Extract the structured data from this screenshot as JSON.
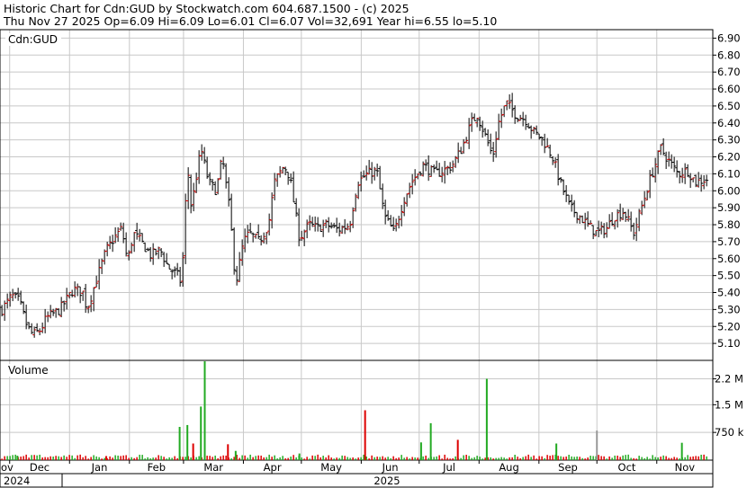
{
  "header": {
    "line1": "Historic Chart for Cdn:GUD by Stockwatch.com 604.687.1500 - (c) 2025",
    "line2": "Thu Nov 27 2025  Op=6.09  Hi=6.09  Lo=6.01  Cl=6.07  Vol=32,691  Year hi=6.55  lo=5.10"
  },
  "price_panel": {
    "label": "Cdn:GUD"
  },
  "volume_panel": {
    "label": "Volume"
  },
  "colors": {
    "up": "#cc0000",
    "down": "#000000",
    "vol_up": "#22aa22",
    "vol_down": "#dd0000",
    "vol_flat": "#999999",
    "grid": "#c8c8c8"
  },
  "chart_data": [
    {
      "type": "ohlc",
      "title": "Cdn:GUD",
      "x_axis": {
        "months": [
          "Dec",
          "Jan",
          "Feb",
          "Mar",
          "Apr",
          "May",
          "Jun",
          "Jul",
          "Aug",
          "Sep",
          "Oct",
          "Nov"
        ],
        "partial_left_label": "ov",
        "years": [
          "2024",
          "2025"
        ]
      },
      "y_axis": {
        "ticks": [
          "5.10",
          "5.20",
          "5.30",
          "5.40",
          "5.50",
          "5.60",
          "5.70",
          "5.80",
          "5.90",
          "6.00",
          "6.10",
          "6.20",
          "6.30",
          "6.40",
          "6.50",
          "6.60",
          "6.70",
          "6.80",
          "6.90"
        ],
        "ylim": [
          5.0,
          6.95
        ],
        "position": "right"
      },
      "grid": true,
      "series_close": [
        {
          "date": "2024-11-27",
          "close": 5.3
        },
        {
          "date": "2024-12-02",
          "close": 5.38
        },
        {
          "date": "2024-12-06",
          "close": 5.35
        },
        {
          "date": "2024-12-10",
          "close": 5.2
        },
        {
          "date": "2024-12-13",
          "close": 5.15
        },
        {
          "date": "2024-12-17",
          "close": 5.18
        },
        {
          "date": "2024-12-20",
          "close": 5.25
        },
        {
          "date": "2024-12-27",
          "close": 5.3
        },
        {
          "date": "2025-01-03",
          "close": 5.42
        },
        {
          "date": "2025-01-08",
          "close": 5.4
        },
        {
          "date": "2025-01-10",
          "close": 5.3
        },
        {
          "date": "2025-01-15",
          "close": 5.48
        },
        {
          "date": "2025-01-20",
          "close": 5.65
        },
        {
          "date": "2025-01-24",
          "close": 5.72
        },
        {
          "date": "2025-01-28",
          "close": 5.78
        },
        {
          "date": "2025-01-31",
          "close": 5.58
        },
        {
          "date": "2025-02-03",
          "close": 5.75
        },
        {
          "date": "2025-02-07",
          "close": 5.7
        },
        {
          "date": "2025-02-12",
          "close": 5.62
        },
        {
          "date": "2025-02-17",
          "close": 5.65
        },
        {
          "date": "2025-02-21",
          "close": 5.55
        },
        {
          "date": "2025-02-26",
          "close": 5.5
        },
        {
          "date": "2025-02-28",
          "close": 5.45
        },
        {
          "date": "2025-03-03",
          "close": 6.15
        },
        {
          "date": "2025-03-05",
          "close": 5.9
        },
        {
          "date": "2025-03-10",
          "close": 6.25
        },
        {
          "date": "2025-03-14",
          "close": 6.05
        },
        {
          "date": "2025-03-18",
          "close": 6.0
        },
        {
          "date": "2025-03-21",
          "close": 6.2
        },
        {
          "date": "2025-03-25",
          "close": 5.87
        },
        {
          "date": "2025-03-28",
          "close": 5.45
        },
        {
          "date": "2025-04-01",
          "close": 5.7
        },
        {
          "date": "2025-04-04",
          "close": 5.75
        },
        {
          "date": "2025-04-09",
          "close": 5.7
        },
        {
          "date": "2025-04-14",
          "close": 5.8
        },
        {
          "date": "2025-04-17",
          "close": 6.05
        },
        {
          "date": "2025-04-22",
          "close": 6.15
        },
        {
          "date": "2025-04-25",
          "close": 6.08
        },
        {
          "date": "2025-04-30",
          "close": 5.72
        },
        {
          "date": "2025-05-05",
          "close": 5.8
        },
        {
          "date": "2025-05-09",
          "close": 5.78
        },
        {
          "date": "2025-05-14",
          "close": 5.8
        },
        {
          "date": "2025-05-20",
          "close": 5.77
        },
        {
          "date": "2025-05-26",
          "close": 5.8
        },
        {
          "date": "2025-05-30",
          "close": 6.05
        },
        {
          "date": "2025-06-04",
          "close": 6.1
        },
        {
          "date": "2025-06-09",
          "close": 6.12
        },
        {
          "date": "2025-06-13",
          "close": 5.85
        },
        {
          "date": "2025-06-18",
          "close": 5.75
        },
        {
          "date": "2025-06-23",
          "close": 5.95
        },
        {
          "date": "2025-06-27",
          "close": 6.05
        },
        {
          "date": "2025-07-03",
          "close": 6.15
        },
        {
          "date": "2025-07-09",
          "close": 6.1
        },
        {
          "date": "2025-07-14",
          "close": 6.12
        },
        {
          "date": "2025-07-18",
          "close": 6.15
        },
        {
          "date": "2025-07-23",
          "close": 6.25
        },
        {
          "date": "2025-07-28",
          "close": 6.4
        },
        {
          "date": "2025-07-31",
          "close": 6.45
        },
        {
          "date": "2025-08-05",
          "close": 6.3
        },
        {
          "date": "2025-08-08",
          "close": 6.2
        },
        {
          "date": "2025-08-11",
          "close": 6.4
        },
        {
          "date": "2025-08-15",
          "close": 6.52
        },
        {
          "date": "2025-08-20",
          "close": 6.45
        },
        {
          "date": "2025-08-25",
          "close": 6.42
        },
        {
          "date": "2025-08-29",
          "close": 6.35
        },
        {
          "date": "2025-09-03",
          "close": 6.3
        },
        {
          "date": "2025-09-08",
          "close": 6.2
        },
        {
          "date": "2025-09-12",
          "close": 6.05
        },
        {
          "date": "2025-09-17",
          "close": 5.9
        },
        {
          "date": "2025-09-22",
          "close": 5.85
        },
        {
          "date": "2025-09-26",
          "close": 5.8
        },
        {
          "date": "2025-10-01",
          "close": 5.75
        },
        {
          "date": "2025-10-06",
          "close": 5.78
        },
        {
          "date": "2025-10-10",
          "close": 5.85
        },
        {
          "date": "2025-10-15",
          "close": 5.88
        },
        {
          "date": "2025-10-20",
          "close": 5.75
        },
        {
          "date": "2025-10-24",
          "close": 5.9
        },
        {
          "date": "2025-10-28",
          "close": 6.05
        },
        {
          "date": "2025-11-03",
          "close": 6.25
        },
        {
          "date": "2025-11-07",
          "close": 6.18
        },
        {
          "date": "2025-11-12",
          "close": 6.1
        },
        {
          "date": "2025-11-17",
          "close": 6.12
        },
        {
          "date": "2025-11-21",
          "close": 6.05
        },
        {
          "date": "2025-11-27",
          "close": 6.07
        }
      ]
    },
    {
      "type": "bar",
      "title": "Volume",
      "y_axis": {
        "ticks": [
          "750 k",
          "1.5 M",
          "2.2 M"
        ],
        "tick_values": [
          750000,
          1500000,
          2200000
        ],
        "ylim": [
          0,
          2700000
        ],
        "position": "right"
      },
      "grid": true,
      "series": [
        {
          "date": "2024-12-05",
          "volume": 120000
        },
        {
          "date": "2025-01-20",
          "volume": 110000
        },
        {
          "date": "2025-02-27",
          "volume": 900000
        },
        {
          "date": "2025-03-03",
          "volume": 950000
        },
        {
          "date": "2025-03-06",
          "volume": 450000
        },
        {
          "date": "2025-03-10",
          "volume": 1450000
        },
        {
          "date": "2025-03-12",
          "volume": 2800000
        },
        {
          "date": "2025-03-24",
          "volume": 430000
        },
        {
          "date": "2025-03-28",
          "volume": 250000
        },
        {
          "date": "2025-04-30",
          "volume": 180000
        },
        {
          "date": "2025-06-03",
          "volume": 1350000
        },
        {
          "date": "2025-07-02",
          "volume": 480000
        },
        {
          "date": "2025-07-07",
          "volume": 1000000
        },
        {
          "date": "2025-07-21",
          "volume": 550000
        },
        {
          "date": "2025-08-05",
          "volume": 2200000
        },
        {
          "date": "2025-09-10",
          "volume": 450000
        },
        {
          "date": "2025-10-01",
          "volume": 800000
        },
        {
          "date": "2025-11-14",
          "volume": 470000
        }
      ]
    }
  ]
}
